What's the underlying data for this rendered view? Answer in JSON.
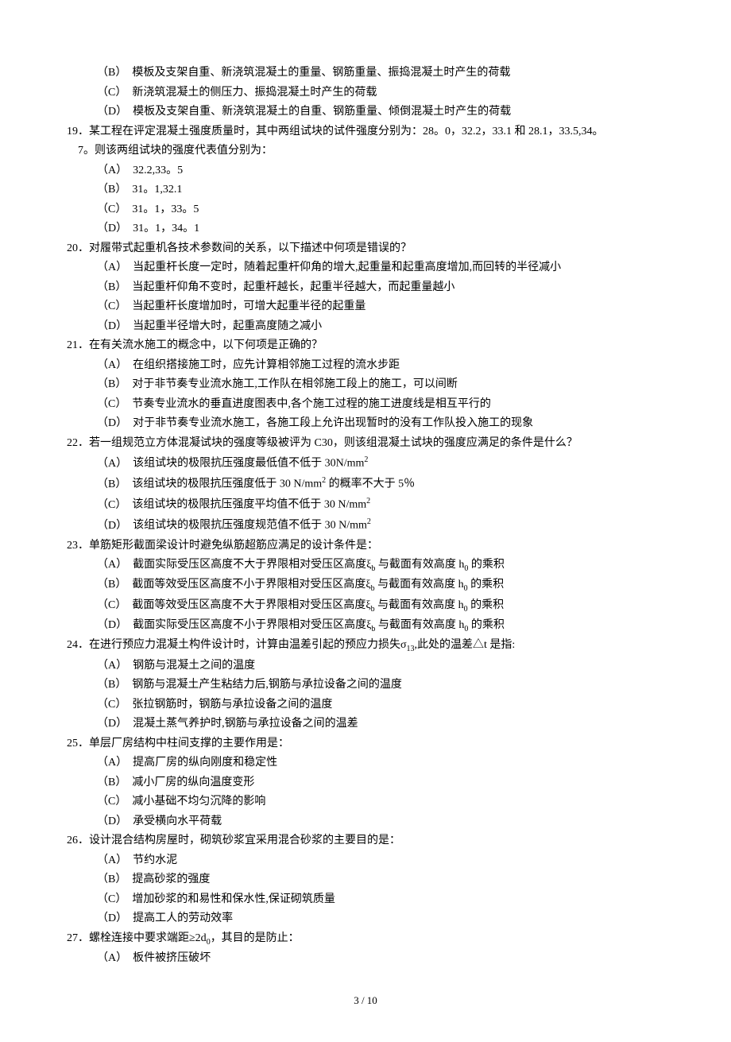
{
  "orphan_options": [
    {
      "label": "（B）",
      "text": "模板及支架自重、新浇筑混凝土的重量、钢筋重量、振捣混凝土时产生的荷载"
    },
    {
      "label": "（C）",
      "text": "新浇筑混凝土的侧压力、振捣混凝土时产生的荷载"
    },
    {
      "label": "（D）",
      "text": "模板及支架自重、新浇筑混凝土的自重、钢筋重量、倾倒混凝土时产生的荷载"
    }
  ],
  "questions": [
    {
      "num": "19．",
      "stem": "某工程在评定混凝土强度质量时，其中两组试块的试件强度分别为：28。0，32.2，33.1 和 28.1，33.5,34。",
      "stem_cont": "7。则该两组试块的强度代表值分别为：",
      "options": [
        {
          "label": "（A）",
          "text": "32.2,33。5"
        },
        {
          "label": "（B）",
          "text": "31。1,32.1"
        },
        {
          "label": "（C）",
          "text": "31。1，33。5"
        },
        {
          "label": "（D）",
          "text": "31。1，34。1"
        }
      ]
    },
    {
      "num": "20．",
      "stem": "对履带式起重机各技术参数间的关系，以下描述中何项是错误的？",
      "options": [
        {
          "label": "（A）",
          "text": "当起重杆长度一定时，随着起重杆仰角的增大,起重量和起重高度增加,而回转的半径减小"
        },
        {
          "label": "（B）",
          "text": "当起重杆仰角不变时，起重杆越长，起重半径越大，而起重量越小"
        },
        {
          "label": "（C）",
          "text": "当起重杆长度增加时，可增大起重半径的起重量"
        },
        {
          "label": "（D）",
          "text": "当起重半径增大时，起重高度随之减小"
        }
      ]
    },
    {
      "num": "21．",
      "stem": "在有关流水施工的概念中，以下何项是正确的？",
      "options": [
        {
          "label": "（A）",
          "text": "在组织搭接施工时，应先计算相邻施工过程的流水步距"
        },
        {
          "label": "（B）",
          "text": "对于非节奏专业流水施工,工作队在相邻施工段上的施工，可以间断"
        },
        {
          "label": "（C）",
          "text": "节奏专业流水的垂直进度图表中,各个施工过程的施工进度线是相互平行的"
        },
        {
          "label": "（D）",
          "text": "对于非节奏专业流水施工，各施工段上允许出现暂时的没有工作队投入施工的现象"
        }
      ]
    },
    {
      "num": "22．",
      "stem": "若一组规范立方体混凝试块的强度等级被评为 C30，则该组混凝土试块的强度应满足的条件是什么？",
      "options": [
        {
          "label": "（A）",
          "text": "该组试块的极限抗压强度最低值不低于 30N/mm",
          "sup": "2"
        },
        {
          "label": "（B）",
          "text": "该组试块的极限抗压强度低于 30 N/mm",
          "sup": "2",
          "tail": " 的概率不大于 5％"
        },
        {
          "label": "（C）",
          "text": "该组试块的极限抗压强度平均值不低于 30 N/mm",
          "sup": "2"
        },
        {
          "label": "（D）",
          "text": "该组试块的极限抗压强度规范值不低于 30 N/mm",
          "sup": "2"
        }
      ]
    },
    {
      "num": "23．",
      "stem": "单筋矩形截面梁设计时避免纵筋超筋应满足的设计条件是：",
      "options": [
        {
          "label": "（A）",
          "text": "截面实际受压区高度不大于界限相对受压区高度ξ",
          "sub": "b",
          "mid": " 与截面有效高度 h",
          "sub2": "0",
          "tail": " 的乘积"
        },
        {
          "label": "（B）",
          "text": "截面等效受压区高度不小于界限相对受压区高度ξ",
          "sub": "b",
          "mid": " 与截面有效高度 h",
          "sub2": "0",
          "tail": " 的乘积"
        },
        {
          "label": "（C）",
          "text": "截面等效受压区高度不大于界限相对受压区高度ξ",
          "sub": "b",
          "mid": " 与截面有效高度 h",
          "sub2": "0",
          "tail": " 的乘积"
        },
        {
          "label": "（D）",
          "text": "截面实际受压区高度不小于界限相对受压区高度ξ",
          "sub": "b",
          "mid": " 与截面有效高度 h",
          "sub2": "0",
          "tail": " 的乘积"
        }
      ]
    },
    {
      "num": "24．",
      "stem": "在进行预应力混凝土构件设计时，计算由温差引起的预应力损失σ",
      "stem_sub": "13",
      "stem_tail": ",此处的温差△t 是指:",
      "options": [
        {
          "label": "（A）",
          "text": "钢筋与混凝土之间的温度"
        },
        {
          "label": "（B）",
          "text": "钢筋与混凝土产生粘结力后,钢筋与承拉设备之间的温度"
        },
        {
          "label": "（C）",
          "text": "张拉钢筋时，钢筋与承拉设备之间的温度"
        },
        {
          "label": "（D）",
          "text": "混凝土蒸气养护时,钢筋与承拉设备之间的温差"
        }
      ]
    },
    {
      "num": "25．",
      "stem": "单层厂房结构中柱间支撑的主要作用是：",
      "options": [
        {
          "label": "（A）",
          "text": "提高厂房的纵向刚度和稳定性"
        },
        {
          "label": "（B）",
          "text": "减小厂房的纵向温度变形"
        },
        {
          "label": "（C）",
          "text": "减小基础不均匀沉降的影响"
        },
        {
          "label": "（D）",
          "text": "承受横向水平荷载"
        }
      ]
    },
    {
      "num": "26．",
      "stem": "设计混合结构房屋时，砌筑砂浆宜采用混合砂浆的主要目的是：",
      "options": [
        {
          "label": "（A）",
          "text": "节约水泥"
        },
        {
          "label": "（B）",
          "text": "提高砂浆的强度"
        },
        {
          "label": "（C）",
          "text": "增加砂浆的和易性和保水性,保证砌筑质量"
        },
        {
          "label": "（D）",
          "text": "提高工人的劳动效率"
        }
      ]
    },
    {
      "num": "27．",
      "stem": "螺栓连接中要求端距≥2d",
      "stem_sub": "0",
      "stem_tail": "，其目的是防止：",
      "options": [
        {
          "label": "（A）",
          "text": "板件被挤压破坏"
        }
      ]
    }
  ],
  "footer": "3  /  10"
}
